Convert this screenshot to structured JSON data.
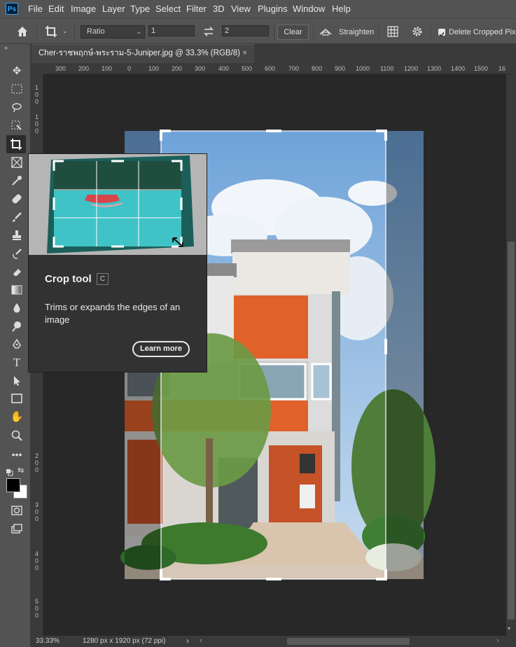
{
  "app": {
    "logo": "Ps"
  },
  "menu": [
    "File",
    "Edit",
    "Image",
    "Layer",
    "Type",
    "Select",
    "Filter",
    "3D",
    "View",
    "Plugins",
    "Window",
    "Help"
  ],
  "options": {
    "ratio_label": "Ratio",
    "width_value": "1",
    "height_value": "2",
    "clear_label": "Clear",
    "straighten_label": "Straighten",
    "delete_cropped_label": "Delete Cropped Pixels"
  },
  "document": {
    "tab_title": "Cher-ราชพฤกษ์-พระราม-5-Juniper.jpg @ 33.3% (RGB/8)",
    "close_glyph": "×"
  },
  "ruler": {
    "h_ticks": [
      "300",
      "200",
      "100",
      "0",
      "100",
      "200",
      "300",
      "400",
      "500",
      "600",
      "700",
      "800",
      "900",
      "1000",
      "1100",
      "1200",
      "1300",
      "1400",
      "1500",
      "16"
    ],
    "v_ticks": [
      "1",
      "0",
      "0",
      "1",
      "0",
      "0",
      "2",
      "0",
      "0",
      "3",
      "0",
      "0",
      "4",
      "0",
      "0",
      "5",
      "0",
      "0"
    ]
  },
  "tooltip": {
    "title": "Crop tool",
    "shortcut": "C",
    "description": "Trims or expands the edges of an image",
    "learn_more": "Learn more"
  },
  "status": {
    "zoom": "33.33%",
    "doc_size": "1280 px x 1920 px (72 ppi)",
    "arrow": "›"
  },
  "colors": {
    "ui_dark": "#535353",
    "canvas_bg": "#282828",
    "accent": "#31a8ff",
    "wall_orange": "#e0612a",
    "sky": "#9cc4e8"
  }
}
